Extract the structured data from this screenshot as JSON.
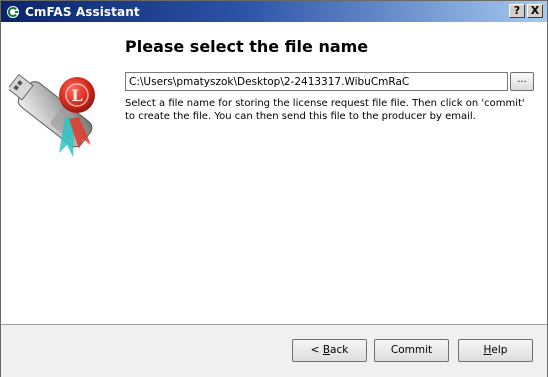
{
  "window": {
    "title": "CmFAS Assistant",
    "help_button": "?",
    "close_button": "X"
  },
  "content": {
    "heading": "Please select the file name",
    "path_value": "C:\\Users\\pmatyszok\\Desktop\\2-2413317.WibuCmRaC",
    "browse_label": "...",
    "description": "Select a file name for storing the license request file file. Then click on 'commit' to create the file. You can then send this file to the producer by email."
  },
  "footer": {
    "back_label_pre": "< ",
    "back_label_mnemonic": "B",
    "back_label_post": "ack",
    "commit_label": "Commit",
    "help_label_mnemonic": "H",
    "help_label_post": "elp"
  },
  "colors": {
    "titlebar_start": "#0a246a",
    "titlebar_end": "#a6caf0",
    "seal_red": "#d22a1e"
  },
  "icons": [
    "app-icon",
    "help-icon",
    "close-icon",
    "usb-license-icon"
  ]
}
